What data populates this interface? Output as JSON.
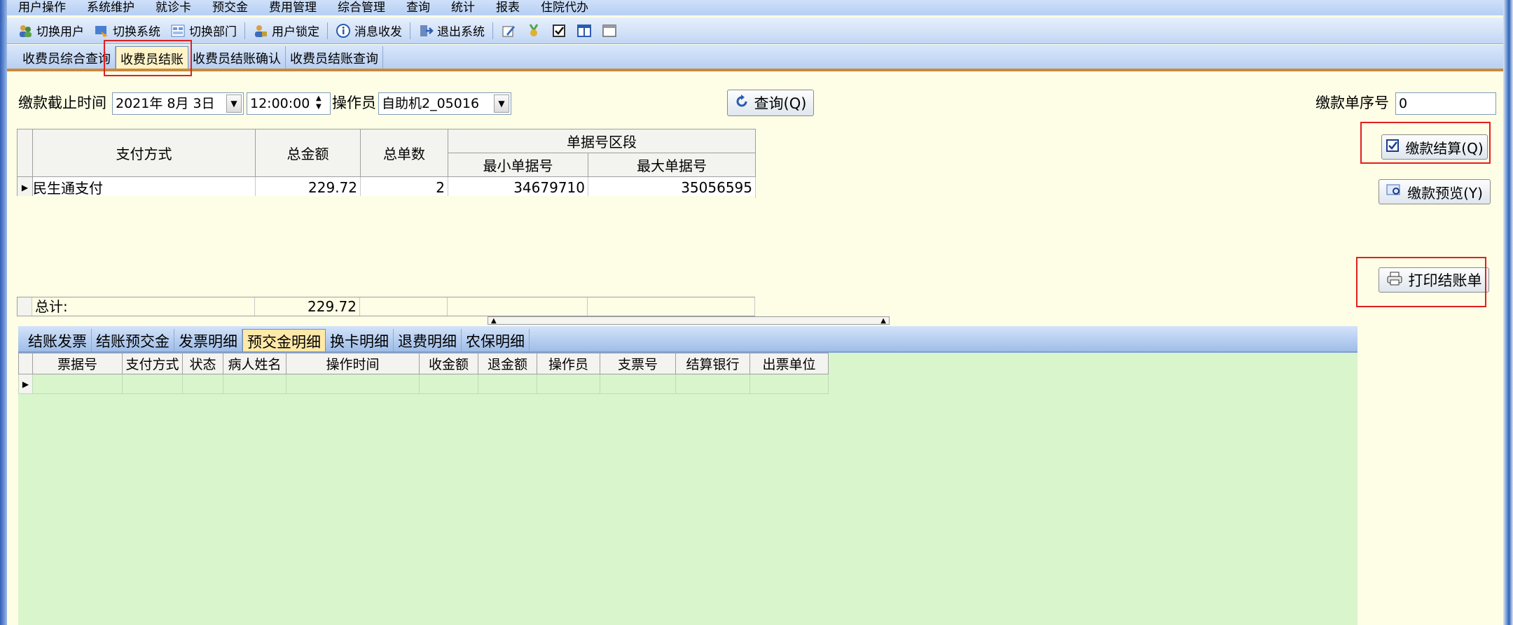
{
  "menubar": [
    "用户操作",
    "系统维护",
    "就诊卡",
    "预交金",
    "费用管理",
    "综合管理",
    "查询",
    "统计",
    "报表",
    "住院代办"
  ],
  "toolbar": {
    "switch_user": "切换用户",
    "switch_system": "切换系统",
    "switch_department": "切换部门",
    "lock_user": "用户锁定",
    "messages": "消息收发",
    "exit_system": "退出系统"
  },
  "module_tabs": [
    "收费员综合查询",
    "收费员结账",
    "收费员结账确认",
    "收费员结账查询"
  ],
  "query": {
    "deadline_label": "缴款截止时间",
    "date_value": "2021年 8月 3日",
    "time_value": "12:00:00",
    "operator_label": "操作员",
    "operator_value": "自助机2_05016",
    "query_button": "查询(Q)",
    "serial_label": "缴款单序号",
    "serial_value": "0"
  },
  "summary": {
    "headers": {
      "payment_method": "支付方式",
      "total_amount": "总金额",
      "total_count": "总单数",
      "range_group": "单据号区段",
      "min_no": "最小单据号",
      "max_no": "最大单据号"
    },
    "rows": [
      {
        "payment_method": "民生通支付",
        "total_amount": "229.72",
        "total_count": "2",
        "min_no": "34679710",
        "max_no": "35056595"
      }
    ],
    "total_label": "总计:",
    "total_amount": "229.72"
  },
  "actions": {
    "settle": "缴款结算(Q)",
    "preview": "缴款预览(Y)",
    "print": "打印结账单"
  },
  "detail_tabs": [
    "结账发票",
    "结账预交金",
    "发票明细",
    "预交金明细",
    "换卡明细",
    "退费明细",
    "农保明细"
  ],
  "detail_headers": [
    "票据号",
    "支付方式",
    "状态",
    "病人姓名",
    "操作时间",
    "收金额",
    "退金额",
    "操作员",
    "支票号",
    "结算银行",
    "出票单位"
  ],
  "colors": {
    "highlight": "#e02020",
    "form_bg": "#fefde6",
    "detail_bg": "#d9f5cc"
  }
}
